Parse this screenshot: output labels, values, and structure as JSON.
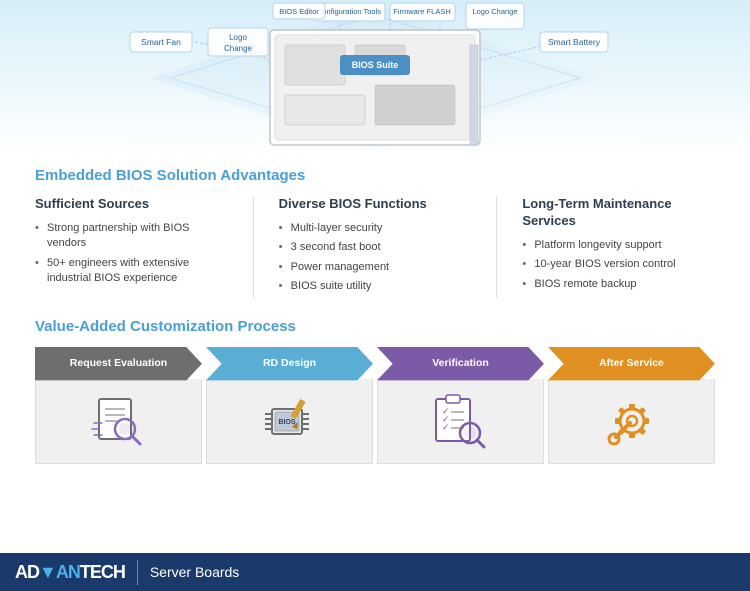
{
  "diagram": {
    "labels": {
      "smart_fan": "Smart Fan",
      "logo_change_left": "Logo Change",
      "configuration_tools": "Configuration Tools",
      "bios_editor": "BIOS Editor",
      "firmware_flash": "Firmware FLASH",
      "logo_change_right": "Logo Change",
      "smart_battery": "Smart Battery",
      "bios_suite": "BIOS Suite"
    }
  },
  "main_section": {
    "title": "Embedded BIOS Solution Advantages",
    "columns": [
      {
        "id": "sufficient-sources",
        "title": "Sufficient Sources",
        "bullets": [
          "Strong partnership with BIOS vendors",
          "50+ engineers with extensive industrial BIOS experience"
        ]
      },
      {
        "id": "diverse-bios",
        "title": "Diverse BIOS Functions",
        "bullets": [
          "Multi-layer security",
          "3 second fast boot",
          "Power management",
          "BIOS suite utility"
        ]
      },
      {
        "id": "long-term",
        "title": "Long-Term Maintenance Services",
        "bullets": [
          "Platform longevity support",
          "10-year BIOS version control",
          "BIOS remote backup"
        ]
      }
    ]
  },
  "value_section": {
    "title": "Value-Added Customization Process",
    "steps": [
      {
        "id": "request-evaluation",
        "label": "Request Evaluation",
        "color": "#6e6e6e",
        "icon": "document-search"
      },
      {
        "id": "rd-design",
        "label": "RD Design",
        "color": "#5aadd4",
        "icon": "bios-chip"
      },
      {
        "id": "verification",
        "label": "Verification",
        "color": "#7b5ba8",
        "icon": "checklist-search"
      },
      {
        "id": "after-service",
        "label": "After Service",
        "color": "#e09020",
        "icon": "wrench-gear"
      }
    ]
  },
  "footer": {
    "brand_ad": "AD",
    "brand_van": "A",
    "brand_full": "AD▼ANTECH",
    "subtitle": "Server Boards",
    "logo_text_1": "AD",
    "logo_text_2": "VAN",
    "logo_text_3": "TECH"
  }
}
